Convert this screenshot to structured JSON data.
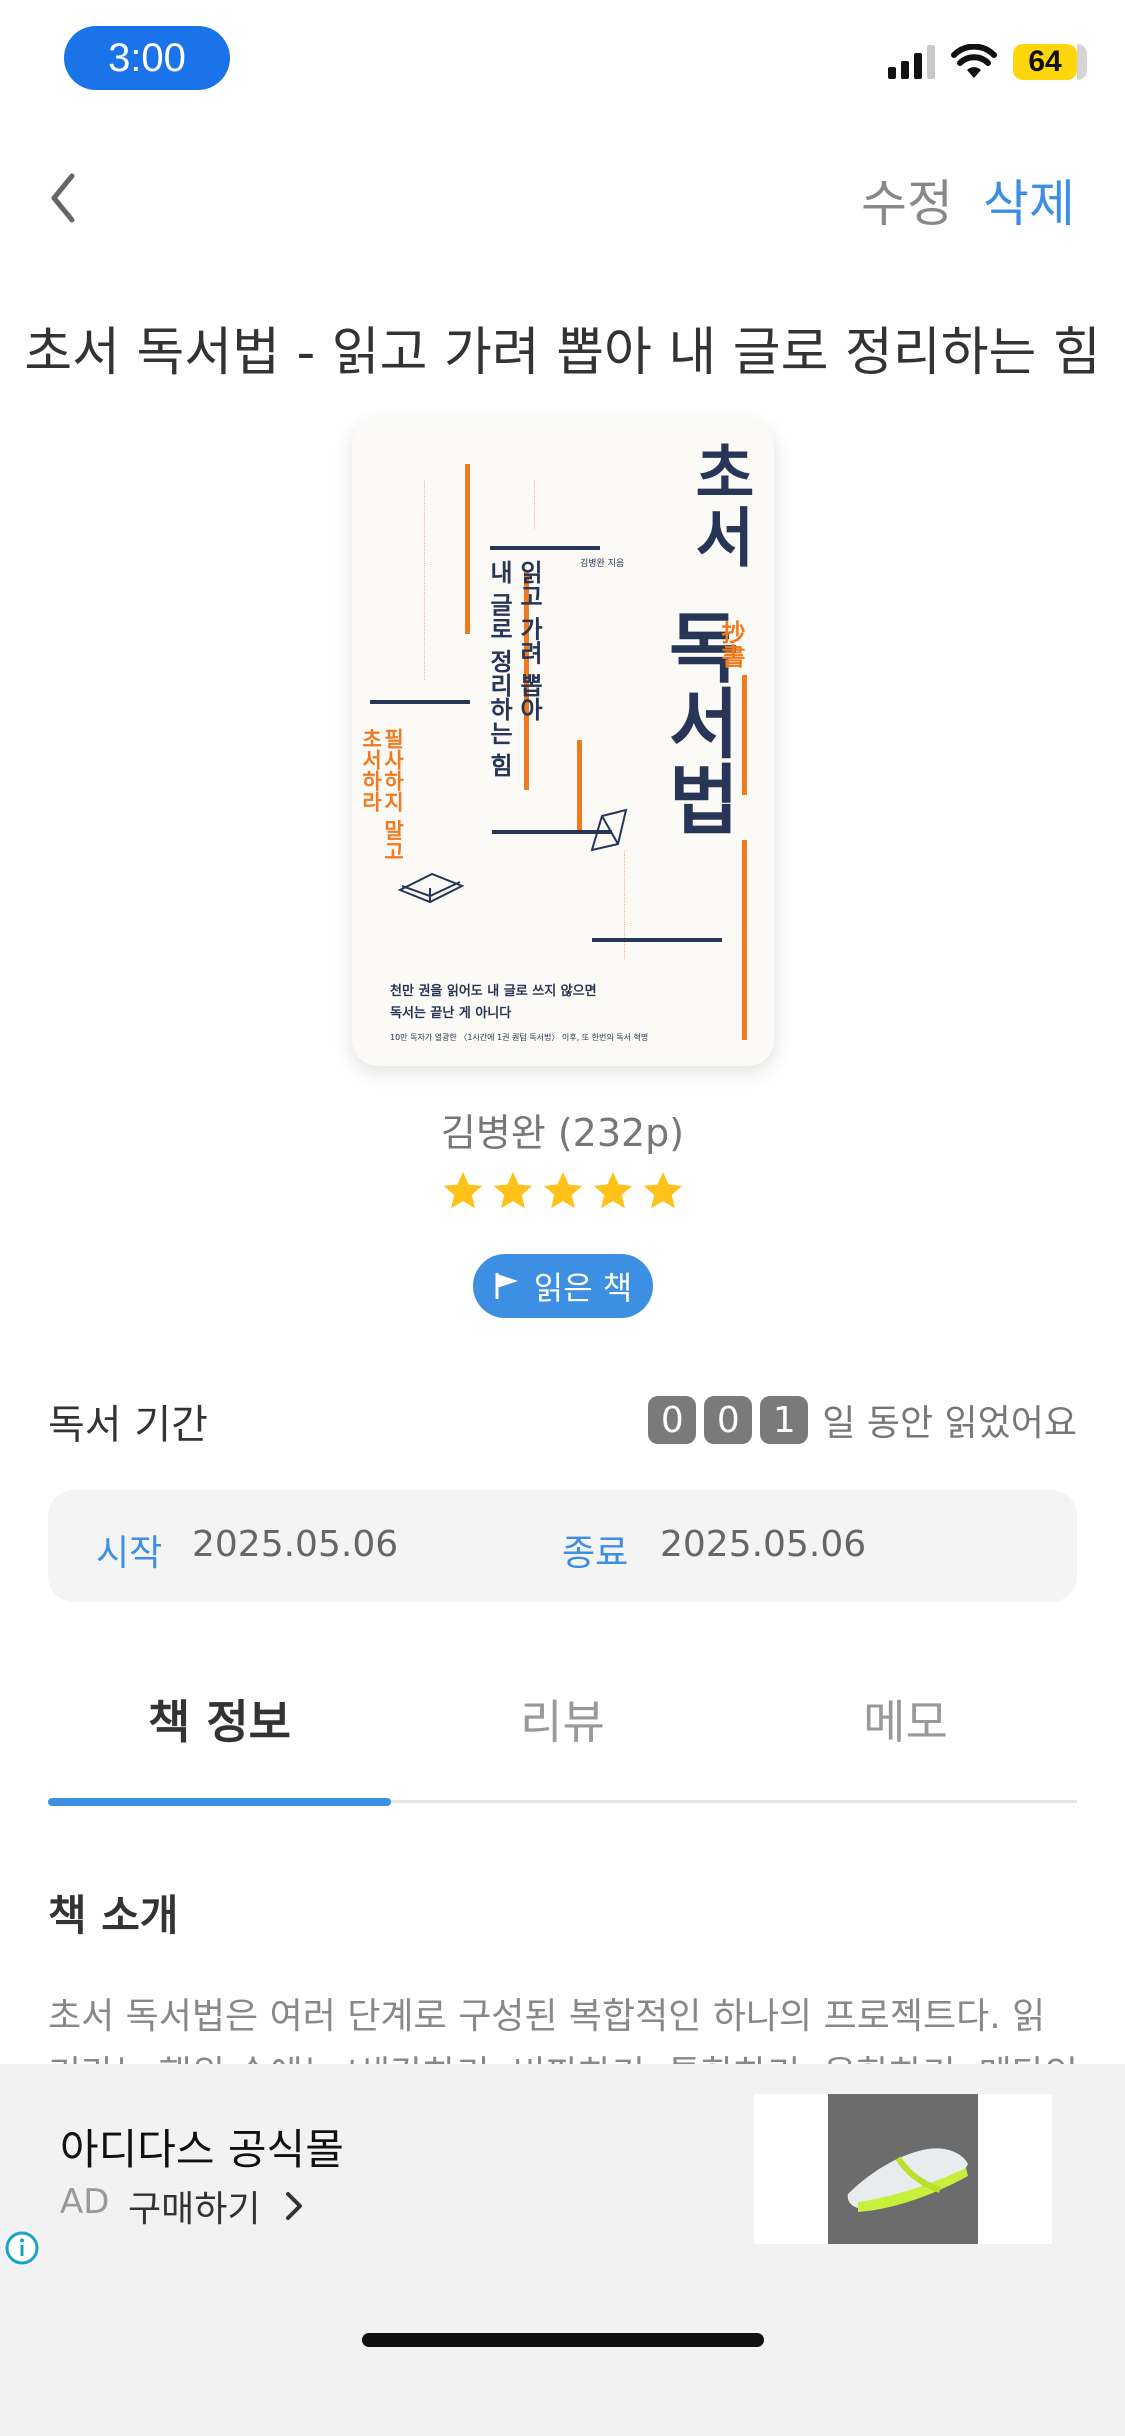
{
  "status_bar": {
    "time": "3:00",
    "battery": "64"
  },
  "nav": {
    "edit": "수정",
    "delete": "삭제"
  },
  "book": {
    "title": "초서 독서법 - 읽고 가려 뽑아 내 글로 정리하는 힘",
    "author_pages": "김병완 (232p)",
    "rating": 5,
    "status_badge": "읽은 책"
  },
  "cover": {
    "main_title_1": "초서",
    "main_title_2": "독서법",
    "hanja": "抄書",
    "subtitle_1": "읽고 가려 뽑아",
    "subtitle_2": "내 글로 정리하는 힘",
    "side_orange": "필사하지 말고",
    "side_navy": "초서하라",
    "author": "김병완 지음",
    "tagline_1": "천만 권을 읽어도 내 글로 쓰지 않으면",
    "tagline_2": "독서는 끝난 게 아니다",
    "footnote": "10만 독자가 열광한 〈1시간에 1권 퀀텀 독서법〉 이후, 또 한번의 독서 혁명"
  },
  "reading_period": {
    "label": "독서 기간",
    "digits": [
      "0",
      "0",
      "1"
    ],
    "suffix": "일 동안 읽었어요",
    "start_label": "시작",
    "start_date": "2025.05.06",
    "end_label": "종료",
    "end_date": "2025.05.06"
  },
  "tabs": [
    "책 정보",
    "리뷰",
    "메모"
  ],
  "intro": {
    "title": "책 소개",
    "text": "초서 독서법은 여러 단계로 구성된 복합적인 하나의 프로젝트다. 읽기라는 행위 속에는 '생각하기, 비판하기, 통합하기, 융합하기, 메타인지하기'가 서"
  },
  "ad": {
    "title": "아디다스 공식몰",
    "tag": "AD",
    "cta": "구매하기"
  }
}
